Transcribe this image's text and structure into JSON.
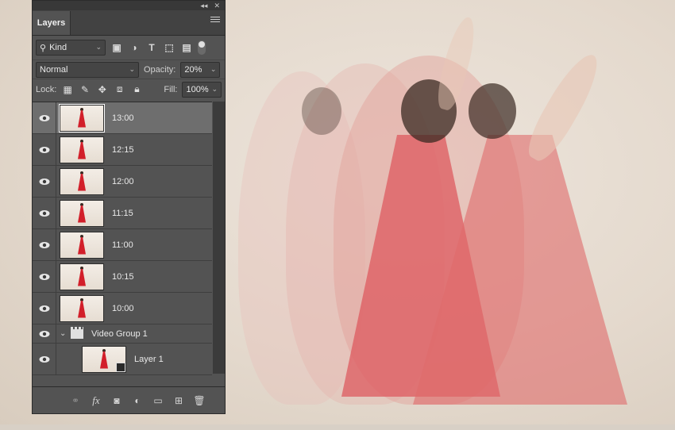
{
  "panel": {
    "tab_label": "Layers",
    "controls": {
      "collapse": "◂◂",
      "close": "✕"
    }
  },
  "filter": {
    "kind_label": "Kind",
    "search_icon": "search-icon",
    "icons": [
      "image-filter-icon",
      "adjustment-filter-icon",
      "type-filter-icon",
      "shape-filter-icon",
      "smart-object-filter-icon"
    ],
    "type_glyph": "T"
  },
  "blend": {
    "mode": "Normal",
    "opacity_label": "Opacity:",
    "opacity_value": "20%"
  },
  "lock": {
    "label": "Lock:",
    "fill_label": "Fill:",
    "fill_value": "100%"
  },
  "layers": [
    {
      "name": "13:00",
      "selected": true
    },
    {
      "name": "12:15",
      "selected": false
    },
    {
      "name": "12:00",
      "selected": false
    },
    {
      "name": "11:15",
      "selected": false
    },
    {
      "name": "11:00",
      "selected": false
    },
    {
      "name": "10:15",
      "selected": false
    },
    {
      "name": "10:00",
      "selected": false
    }
  ],
  "group": {
    "name": "Video Group 1",
    "expanded": true
  },
  "sub_layer": {
    "name": "Layer 1"
  },
  "bottom_bar": {
    "icons": [
      "link-layers-icon",
      "fx-icon",
      "add-mask-icon",
      "new-fill-adjustment-icon",
      "new-group-icon",
      "new-layer-icon",
      "delete-layer-icon"
    ],
    "fx_label": "fx"
  },
  "colors": {
    "panel_bg": "#535353",
    "selected_row": "#6e6e6e",
    "dress_red": "#d21f2a"
  }
}
